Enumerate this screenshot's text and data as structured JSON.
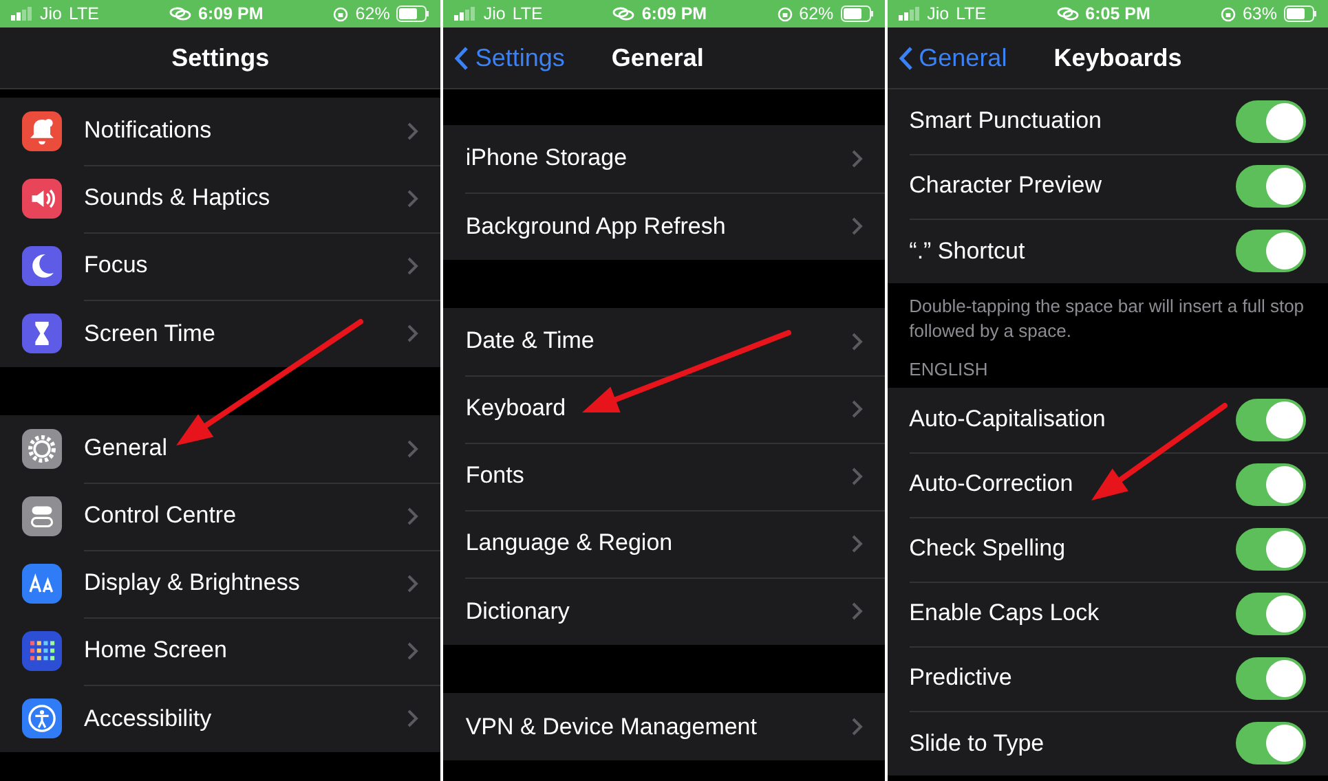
{
  "screens": [
    {
      "status_bar": {
        "carrier": "Jio",
        "network": "LTE",
        "time": "6:09 PM",
        "battery": "62%"
      },
      "nav": {
        "title": "Settings"
      },
      "groups": [
        {
          "rows": [
            {
              "label": "Notifications",
              "kind": "bell",
              "color": "#eb4d3d"
            },
            {
              "label": "Sounds & Haptics",
              "kind": "speaker",
              "color": "#e8445a"
            },
            {
              "label": "Focus",
              "kind": "moon",
              "color": "#5e5ce6"
            },
            {
              "label": "Screen Time",
              "kind": "hourglass",
              "color": "#5e5ce6"
            }
          ]
        },
        {
          "rows": [
            {
              "label": "General",
              "kind": "gear",
              "color": "#8e8e93"
            },
            {
              "label": "Control Centre",
              "kind": "switches",
              "color": "#8e8e93"
            },
            {
              "label": "Display & Brightness",
              "kind": "aa",
              "color": "#2f7cf6"
            },
            {
              "label": "Home Screen",
              "kind": "grid",
              "color": "#2d4fd6"
            },
            {
              "label": "Accessibility",
              "kind": "person",
              "color": "#2f7cf6"
            }
          ]
        }
      ]
    },
    {
      "status_bar": {
        "carrier": "Jio",
        "network": "LTE",
        "time": "6:09 PM",
        "battery": "62%"
      },
      "nav": {
        "back": "Settings",
        "title": "General"
      },
      "groups": [
        {
          "rows": [
            {
              "label": "iPhone Storage"
            },
            {
              "label": "Background App Refresh"
            }
          ]
        },
        {
          "rows": [
            {
              "label": "Date & Time"
            },
            {
              "label": "Keyboard"
            },
            {
              "label": "Fonts"
            },
            {
              "label": "Language & Region"
            },
            {
              "label": "Dictionary"
            }
          ]
        },
        {
          "rows": [
            {
              "label": "VPN & Device Management"
            }
          ]
        }
      ]
    },
    {
      "status_bar": {
        "carrier": "Jio",
        "network": "LTE",
        "time": "6:05 PM",
        "battery": "63%"
      },
      "nav": {
        "back": "General",
        "title": "Keyboards"
      },
      "groups": [
        {
          "rows": [
            {
              "label": "Smart Punctuation",
              "on": true
            },
            {
              "label": "Character Preview",
              "on": true
            },
            {
              "label": "“.” Shortcut",
              "on": true
            }
          ],
          "footer": "Double-tapping the space bar will insert a full stop followed by a space."
        },
        {
          "header": "ENGLISH",
          "rows": [
            {
              "label": "Auto-Capitalisation",
              "on": true
            },
            {
              "label": "Auto-Correction",
              "on": true
            },
            {
              "label": "Check Spelling",
              "on": true
            },
            {
              "label": "Enable Caps Lock",
              "on": true
            },
            {
              "label": "Predictive",
              "on": true
            },
            {
              "label": "Slide to Type",
              "on": true
            }
          ]
        }
      ]
    }
  ]
}
